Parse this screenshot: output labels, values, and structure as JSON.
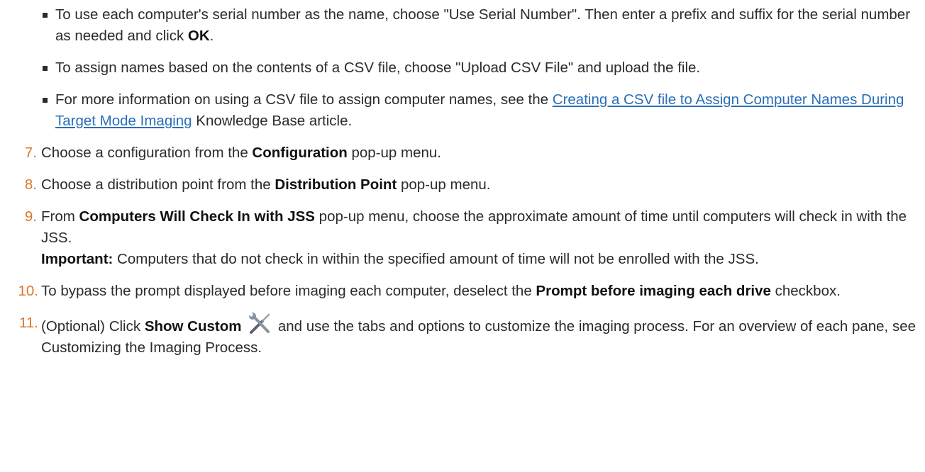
{
  "bullets": [
    {
      "pre": "To use each computer's serial number as the name, choose \"Use Serial Number\". Then enter a prefix and suffix for the serial number as needed and click ",
      "bold": "OK",
      "post": "."
    },
    {
      "text": "To assign names based on the contents of a CSV file, choose \"Upload CSV File\" and upload the file."
    },
    {
      "pre": "For more information on using a CSV file to assign computer names, see the ",
      "link": "Creating a CSV file to Assign Computer Names During Target Mode Imaging",
      "post": " Knowledge Base article."
    }
  ],
  "steps": {
    "s7": {
      "num": "7.",
      "pre": "Choose a configuration from the ",
      "bold": "Configuration",
      "post": " pop-up menu."
    },
    "s8": {
      "num": "8.",
      "pre": "Choose a distribution point from the ",
      "bold": "Distribution Point",
      "post": " pop-up menu."
    },
    "s9": {
      "num": "9.",
      "pre": "From ",
      "bold": "Computers Will Check In with JSS",
      "post": " pop-up menu, choose the approximate amount of time until computers will check in with the JSS.",
      "note_label": "Important:",
      "note_text": " Computers that do not check in within the specified amount of time will not be enrolled with the JSS."
    },
    "s10": {
      "num": "10.",
      "pre": "To bypass the prompt displayed before imaging each computer, deselect the ",
      "bold": "Prompt before imaging each drive",
      "post": " checkbox."
    },
    "s11": {
      "num": "11.",
      "pre": "(Optional) Click ",
      "bold": "Show Custom",
      "icon": "tools-icon",
      "post": " and use the tabs and options to customize the imaging process. For an overview of each pane, see Customizing the Imaging Process."
    }
  },
  "colors": {
    "text": "#2b2b2b",
    "step_number": "#e0742b",
    "link": "#2a6fb8"
  }
}
